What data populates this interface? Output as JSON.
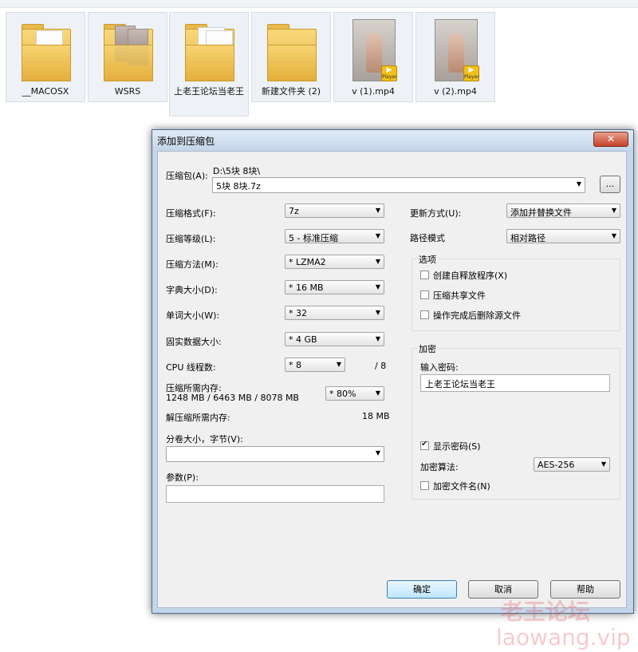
{
  "explorer": {
    "files": [
      {
        "name": "__MACOSX",
        "type": "folder"
      },
      {
        "name": "WSRS",
        "type": "folder-photos"
      },
      {
        "name": "上老王论坛当老王",
        "type": "folder-docs"
      },
      {
        "name": "新建文件夹 (2)",
        "type": "folder-empty"
      },
      {
        "name": "v (1).mp4",
        "type": "video"
      },
      {
        "name": "v (2).mp4",
        "type": "video"
      }
    ],
    "video_badge_text": "Player"
  },
  "dialog": {
    "title": "添加到压缩包",
    "close_symbol": "✕",
    "archive": {
      "label": "压缩包(A):",
      "path": "D:\\5块 8块\\",
      "filename": "5块 8块.7z",
      "browse_label": "..."
    },
    "left": {
      "format": {
        "label": "压缩格式(F):",
        "value": "7z"
      },
      "level": {
        "label": "压缩等级(L):",
        "value": "5 - 标准压缩"
      },
      "method": {
        "label": "压缩方法(M):",
        "value": "* LZMA2"
      },
      "dict": {
        "label": "字典大小(D):",
        "value": "* 16 MB"
      },
      "word": {
        "label": "单词大小(W):",
        "value": "* 32"
      },
      "solid": {
        "label": "固实数据大小:",
        "value": "* 4 GB"
      },
      "threads": {
        "label": "CPU 线程数:",
        "value": "* 8",
        "total": "/ 8"
      },
      "mem_comp": {
        "label": "压缩所需内存:",
        "detail": "1248 MB / 6463 MB / 8078 MB",
        "value": "* 80%"
      },
      "mem_decomp": {
        "label": "解压缩所需内存:",
        "value": "18 MB"
      },
      "volume": {
        "label": "分卷大小，字节(V):",
        "value": ""
      },
      "params": {
        "label": "参数(P):",
        "value": ""
      }
    },
    "right": {
      "update": {
        "label": "更新方式(U):",
        "value": "添加并替换文件"
      },
      "pathmode": {
        "label": "路径模式",
        "value": "相对路径"
      },
      "options": {
        "title": "选项",
        "sfx": "创建自释放程序(X)",
        "shared": "压缩共享文件",
        "delete": "操作完成后删除源文件"
      },
      "encrypt": {
        "title": "加密",
        "pw_label": "输入密码:",
        "password": "上老王论坛当老王",
        "show_pw": "显示密码(S)",
        "method_label": "加密算法:",
        "method": "AES-256",
        "encrypt_names": "加密文件名(N)"
      }
    },
    "buttons": {
      "ok": "确定",
      "cancel": "取消",
      "help": "帮助"
    }
  },
  "watermark": {
    "line1": "老王论坛",
    "line2": "laowang.vip"
  }
}
